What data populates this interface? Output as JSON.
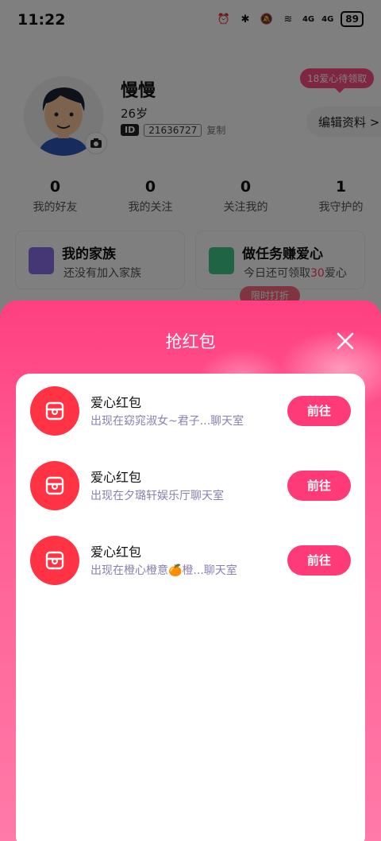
{
  "status_bar": {
    "time": "11:22",
    "sig1": "4G",
    "sig2": "4G",
    "battery": "89"
  },
  "profile": {
    "nickname": "慢慢",
    "age": "26岁",
    "id_tag": "ID",
    "id_number": "21636727",
    "copy_label": "复制",
    "love_badge": "18爱心待领取",
    "edit_label": "编辑资料 >"
  },
  "stats": [
    {
      "value": "0",
      "label": "我的好友"
    },
    {
      "value": "0",
      "label": "我的关注"
    },
    {
      "value": "0",
      "label": "关注我的"
    },
    {
      "value": "1",
      "label": "我守护的"
    }
  ],
  "cards": {
    "family": {
      "title": "我的家族",
      "subtitle": "还没有加入家族"
    },
    "task": {
      "title": "做任务赚爱心",
      "sub_prefix": "今日还可领取",
      "sub_value": "30",
      "sub_suffix": "爱心",
      "tag": "限时打折"
    }
  },
  "sheet": {
    "title": "抢红包",
    "items": [
      {
        "title": "爱心红包",
        "subtitle": "出现在窈窕淑女~君子...聊天室",
        "button": "前往"
      },
      {
        "title": "爱心红包",
        "subtitle": "出现在夕璐轩娱乐厅聊天室",
        "button": "前往"
      },
      {
        "title": "爱心红包",
        "subtitle": "出现在橙心橙意🍊橙...聊天室",
        "button": "前往"
      }
    ]
  },
  "colors": {
    "accent": "#ff3a78",
    "packet_red": "#ff3344",
    "sheet_top": "#ff3f80",
    "sheet_bottom": "#ff7aa8",
    "subtitle": "#8a7fb0"
  }
}
